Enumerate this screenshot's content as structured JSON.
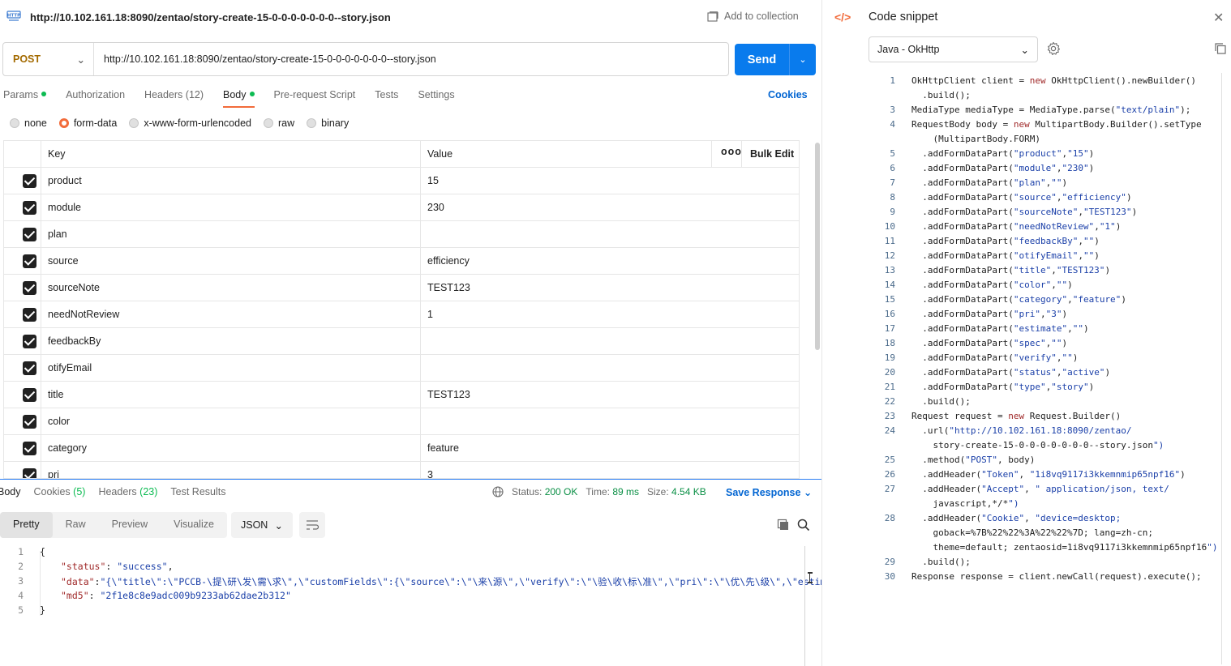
{
  "request": {
    "title": "http://10.102.161.18:8090/zentao/story-create-15-0-0-0-0-0-0-0--story.json",
    "add_to_collection": "Add to collection",
    "method": "POST",
    "url": "http://10.102.161.18:8090/zentao/story-create-15-0-0-0-0-0-0-0--story.json",
    "send_label": "Send",
    "tabs": [
      {
        "label": "Params"
      },
      {
        "label": "Authorization"
      },
      {
        "label": "Headers",
        "count": "(12)"
      },
      {
        "label": "Body"
      },
      {
        "label": "Pre-request Script"
      },
      {
        "label": "Tests"
      },
      {
        "label": "Settings"
      }
    ],
    "cookies_label": "Cookies",
    "body_types": [
      "none",
      "form-data",
      "x-www-form-urlencoded",
      "raw",
      "binary"
    ],
    "selected_body_type": "form-data",
    "table": {
      "headers": {
        "key": "Key",
        "value": "Value",
        "more": "ooo",
        "bulk_edit": "Bulk Edit"
      },
      "rows": [
        {
          "key": "product",
          "value": "15"
        },
        {
          "key": "module",
          "value": "230"
        },
        {
          "key": "plan",
          "value": ""
        },
        {
          "key": "source",
          "value": "efficiency"
        },
        {
          "key": "sourceNote",
          "value": "TEST123"
        },
        {
          "key": "needNotReview",
          "value": "1"
        },
        {
          "key": "feedbackBy",
          "value": ""
        },
        {
          "key": "otifyEmail",
          "value": ""
        },
        {
          "key": "title",
          "value": "TEST123"
        },
        {
          "key": "color",
          "value": ""
        },
        {
          "key": "category",
          "value": "feature"
        },
        {
          "key": "pri",
          "value": "3"
        }
      ]
    }
  },
  "response": {
    "tabs": [
      {
        "label": "Body"
      },
      {
        "label": "Cookies",
        "count": "(5)"
      },
      {
        "label": "Headers",
        "count": "(23)"
      },
      {
        "label": "Test Results"
      }
    ],
    "status_label": "Status:",
    "status_value": "200 OK",
    "time_label": "Time:",
    "time_value": "89 ms",
    "size_label": "Size:",
    "size_value": "4.54 KB",
    "save_response": "Save Response",
    "view_tabs": [
      "Pretty",
      "Raw",
      "Preview",
      "Visualize"
    ],
    "format": "JSON",
    "lines": [
      {
        "n": "1",
        "text": "{"
      },
      {
        "n": "2",
        "key": "\"status\"",
        "sep": ": ",
        "val": "\"success\"",
        "end": ","
      },
      {
        "n": "3",
        "key": "\"data\"",
        "sep": ":",
        "val": "\"{\\\"title\\\":\\\"PCCB-\\提\\研\\发\\需\\求\\\",\\\"customFields\\\":{\\\"source\\\":\\\"\\来\\源\\\",\\\"verify\\\":\\\"\\验\\收\\标\\准\\\",\\\"pri\\\":\\\"\\优\\先\\级\\\",\\\"estimate",
        "end": ""
      },
      {
        "n": "4",
        "key": "\"md5\"",
        "sep": ": ",
        "val": "\"2f1e8c8e9adc009b9233ab62dae2b312\"",
        "end": ""
      },
      {
        "n": "5",
        "text": "}"
      }
    ]
  },
  "snippet": {
    "title": "Code snippet",
    "language": "Java - OkHttp",
    "lines": [
      {
        "n": "1",
        "text": "OkHttpClient client = new OkHttpClient().newBuilder()"
      },
      {
        "n": "",
        "text": "  .build();"
      },
      {
        "n": "3",
        "text": "MediaType mediaType = MediaType.parse(\"text/plain\");"
      },
      {
        "n": "4",
        "text": "RequestBody body = new MultipartBody.Builder().setType"
      },
      {
        "n": "",
        "text": "    (MultipartBody.FORM)"
      },
      {
        "n": "5",
        "text": "  .addFormDataPart(\"product\",\"15\")"
      },
      {
        "n": "6",
        "text": "  .addFormDataPart(\"module\",\"230\")"
      },
      {
        "n": "7",
        "text": "  .addFormDataPart(\"plan\",\"\")"
      },
      {
        "n": "8",
        "text": "  .addFormDataPart(\"source\",\"efficiency\")"
      },
      {
        "n": "9",
        "text": "  .addFormDataPart(\"sourceNote\",\"TEST123\")"
      },
      {
        "n": "10",
        "text": "  .addFormDataPart(\"needNotReview\",\"1\")"
      },
      {
        "n": "11",
        "text": "  .addFormDataPart(\"feedbackBy\",\"\")"
      },
      {
        "n": "12",
        "text": "  .addFormDataPart(\"otifyEmail\",\"\")"
      },
      {
        "n": "13",
        "text": "  .addFormDataPart(\"title\",\"TEST123\")"
      },
      {
        "n": "14",
        "text": "  .addFormDataPart(\"color\",\"\")"
      },
      {
        "n": "15",
        "text": "  .addFormDataPart(\"category\",\"feature\")"
      },
      {
        "n": "16",
        "text": "  .addFormDataPart(\"pri\",\"3\")"
      },
      {
        "n": "17",
        "text": "  .addFormDataPart(\"estimate\",\"\")"
      },
      {
        "n": "18",
        "text": "  .addFormDataPart(\"spec\",\"\")"
      },
      {
        "n": "19",
        "text": "  .addFormDataPart(\"verify\",\"\")"
      },
      {
        "n": "20",
        "text": "  .addFormDataPart(\"status\",\"active\")"
      },
      {
        "n": "21",
        "text": "  .addFormDataPart(\"type\",\"story\")"
      },
      {
        "n": "22",
        "text": "  .build();"
      },
      {
        "n": "23",
        "text": "Request request = new Request.Builder()"
      },
      {
        "n": "24",
        "text": "  .url(\"http://10.102.161.18:8090/zentao/"
      },
      {
        "n": "",
        "text": "    story-create-15-0-0-0-0-0-0-0--story.json\")"
      },
      {
        "n": "25",
        "text": "  .method(\"POST\", body)"
      },
      {
        "n": "26",
        "text": "  .addHeader(\"Token\", \"1i8vq9117i3kkemnmip65npf16\")"
      },
      {
        "n": "27",
        "text": "  .addHeader(\"Accept\", \" application/json, text/"
      },
      {
        "n": "",
        "text": "    javascript,*/*\")"
      },
      {
        "n": "28",
        "text": "  .addHeader(\"Cookie\", \"device=desktop;"
      },
      {
        "n": "",
        "text": "    goback=%7B%22%22%3A%22%22%7D; lang=zh-cn;"
      },
      {
        "n": "",
        "text": "    theme=default; zentaosid=1i8vq9117i3kkemnmip65npf16\")"
      },
      {
        "n": "29",
        "text": "  .build();"
      },
      {
        "n": "30",
        "text": "Response response = client.newCall(request).execute();"
      }
    ]
  },
  "icons": {
    "http": "http-icon",
    "collection": "folder-plus-icon",
    "gear": "gear-icon",
    "copy": "copy-icon",
    "search": "search-icon",
    "close": "close-icon",
    "code": "code-icon",
    "wrap": "wrap-icon",
    "globe": "globe-icon"
  },
  "colors": {
    "accent": "#f26b3a",
    "send": "#097bed",
    "link": "#0265d2",
    "ok": "#0cbb52"
  }
}
